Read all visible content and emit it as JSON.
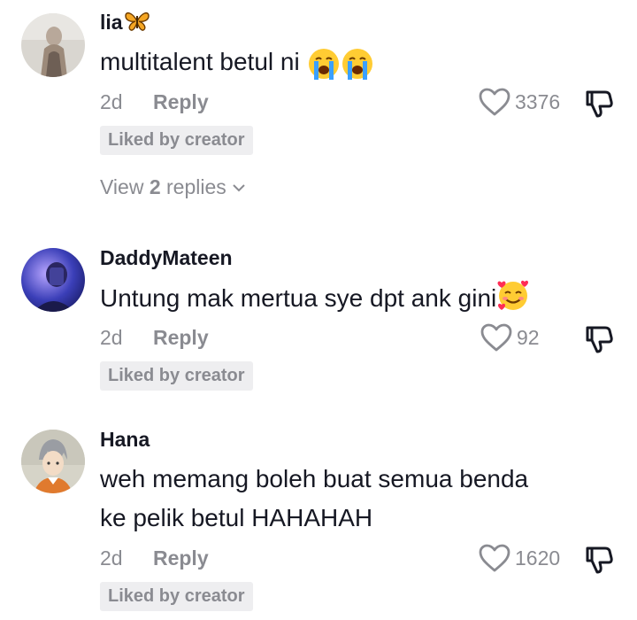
{
  "comments": [
    {
      "username": "lia",
      "username_emoji": "butterfly",
      "text": "multitalent betul ni",
      "text_emojis": [
        "loudly-crying-face",
        "loudly-crying-face"
      ],
      "age": "2d",
      "reply_label": "Reply",
      "likes": "3376",
      "badge": "Liked by creator",
      "view_replies_prefix": "View ",
      "view_replies_count": "2",
      "view_replies_suffix": " replies"
    },
    {
      "username": "DaddyMateen",
      "text": "Untung mak mertua sye dpt ank gini",
      "text_emojis": [
        "smiling-face-with-hearts"
      ],
      "age": "2d",
      "reply_label": "Reply",
      "likes": "92",
      "badge": "Liked by creator"
    },
    {
      "username": "Hana",
      "text_line1": "weh memang boleh buat semua benda",
      "text_line2": "ke pelik betul HAHAHAH",
      "age": "2d",
      "reply_label": "Reply",
      "likes": "1620",
      "badge": "Liked by creator"
    }
  ],
  "colors": {
    "text": "#161823",
    "muted": "#8a8b91",
    "badge_bg": "#eeeef0"
  }
}
